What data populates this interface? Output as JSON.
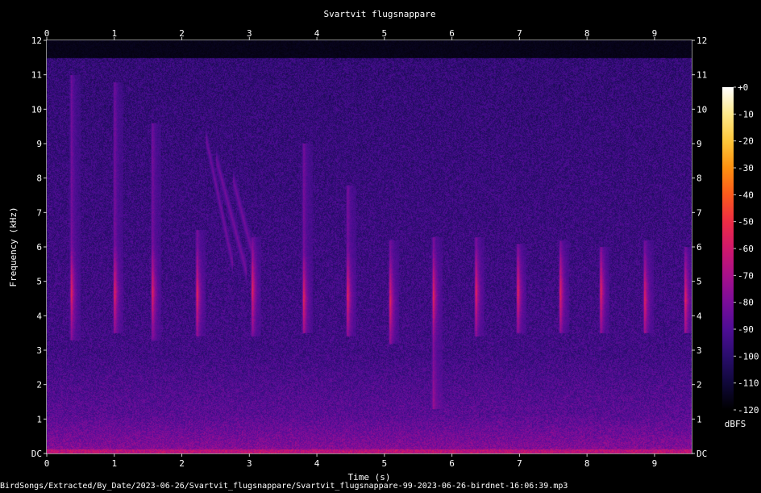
{
  "chart_data": {
    "type": "heatmap",
    "subtype": "spectrogram",
    "title": "Svartvit flugsnappare",
    "xlabel": "Time (s)",
    "ylabel": "Frequency (kHz)",
    "xlim": [
      0,
      9.55
    ],
    "ylim": [
      0,
      12
    ],
    "x_ticks": [
      "0",
      "1",
      "2",
      "3",
      "4",
      "5",
      "6",
      "7",
      "8",
      "9"
    ],
    "y_ticks": [
      "DC",
      "1",
      "2",
      "3",
      "4",
      "5",
      "6",
      "7",
      "8",
      "9",
      "10",
      "11",
      "12"
    ],
    "colorbar": {
      "label": "dBFS",
      "range": [
        -120,
        0
      ],
      "ticks": [
        "+0",
        "-10",
        "-20",
        "-30",
        "-40",
        "-50",
        "-60",
        "-70",
        "-80",
        "-90",
        "-100",
        "-110",
        "-120"
      ],
      "colors": [
        "#000000",
        "#10083a",
        "#2a0d6e",
        "#4e0d95",
        "#7a0d9a",
        "#a8108a",
        "#d0186c",
        "#ee2c44",
        "#fb5a1c",
        "#fd9010",
        "#fdc63a",
        "#fee98a",
        "#ffffff"
      ]
    },
    "background_energy_cutoff_khz": 11.5,
    "calls": [
      {
        "t": 0.36,
        "f_low": 3.3,
        "f_high": 11.0,
        "peak_khz": 4.7
      },
      {
        "t": 1.0,
        "f_low": 3.5,
        "f_high": 10.8,
        "peak_khz": 4.7
      },
      {
        "t": 1.56,
        "f_low": 3.3,
        "f_high": 9.6,
        "peak_khz": 4.7
      },
      {
        "t": 2.22,
        "f_low": 3.4,
        "f_high": 6.5,
        "peak_khz": 4.6
      },
      {
        "t": 3.04,
        "f_low": 3.4,
        "f_high": 6.3,
        "peak_khz": 4.8
      },
      {
        "t": 3.8,
        "f_low": 3.5,
        "f_high": 9.0,
        "peak_khz": 4.5
      },
      {
        "t": 4.45,
        "f_low": 3.4,
        "f_high": 7.8,
        "peak_khz": 4.6
      },
      {
        "t": 5.08,
        "f_low": 3.2,
        "f_high": 6.2,
        "peak_khz": 4.4
      },
      {
        "t": 5.72,
        "f_low": 1.3,
        "f_high": 6.3,
        "peak_khz": 4.6
      },
      {
        "t": 6.35,
        "f_low": 3.4,
        "f_high": 6.3,
        "peak_khz": 4.7
      },
      {
        "t": 6.97,
        "f_low": 3.5,
        "f_high": 6.1,
        "peak_khz": 4.7
      },
      {
        "t": 7.6,
        "f_low": 3.5,
        "f_high": 6.2,
        "peak_khz": 4.7
      },
      {
        "t": 8.2,
        "f_low": 3.5,
        "f_high": 6.0,
        "peak_khz": 4.7
      },
      {
        "t": 8.85,
        "f_low": 3.5,
        "f_high": 6.2,
        "peak_khz": 4.5
      },
      {
        "t": 9.45,
        "f_low": 3.5,
        "f_high": 6.0,
        "peak_khz": 4.5
      }
    ],
    "sweeps": [
      {
        "t_start": 2.35,
        "t_end": 2.75,
        "f_start": 9.2,
        "f_end": 5.5
      },
      {
        "t_start": 2.5,
        "t_end": 2.95,
        "f_start": 8.6,
        "f_end": 5.3
      },
      {
        "t_start": 2.75,
        "t_end": 3.1,
        "f_start": 8.0,
        "f_end": 5.4
      }
    ]
  },
  "footer": {
    "path": "BirdSongs/Extracted/By_Date/2023-06-26/Svartvit_flugsnappare/Svartvit_flugsnappare-99-2023-06-26-birdnet-16:06:39.mp3"
  }
}
